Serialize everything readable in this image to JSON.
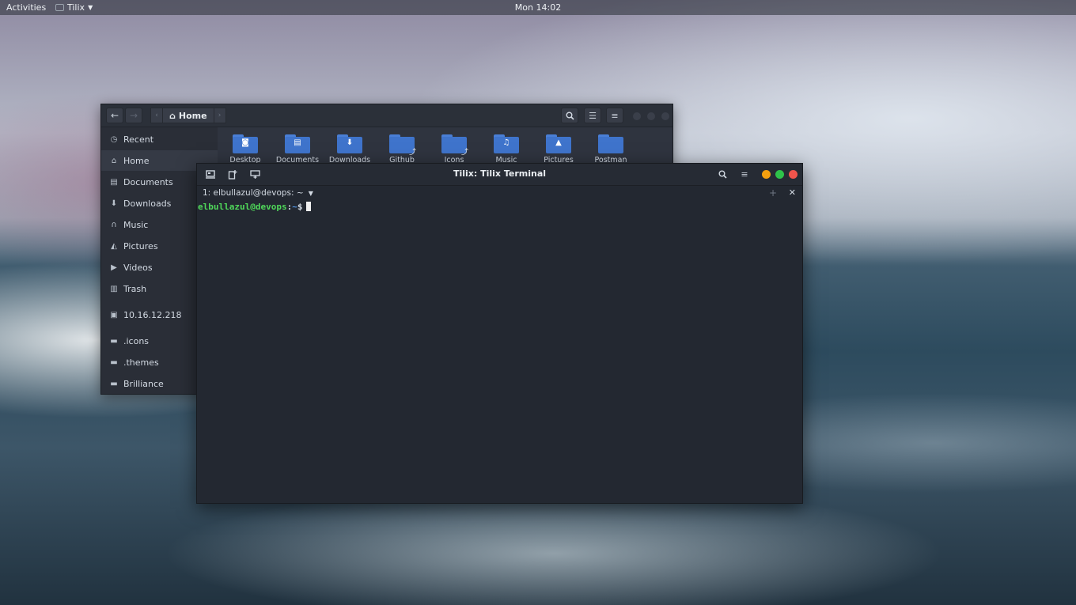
{
  "topbar": {
    "activities": "Activities",
    "app_name": "Tilix",
    "clock": "Mon 14:02"
  },
  "files": {
    "location": "Home",
    "sidebar": [
      {
        "label": "Recent",
        "icon": "clock-icon"
      },
      {
        "label": "Home",
        "icon": "home-icon",
        "active": true
      },
      {
        "label": "Documents",
        "icon": "document-icon"
      },
      {
        "label": "Downloads",
        "icon": "download-icon"
      },
      {
        "label": "Music",
        "icon": "headphones-icon"
      },
      {
        "label": "Pictures",
        "icon": "image-icon"
      },
      {
        "label": "Videos",
        "icon": "video-icon"
      },
      {
        "label": "Trash",
        "icon": "trash-icon"
      },
      {
        "label": "10.16.12.218",
        "icon": "network-folder-icon"
      },
      {
        "label": ".icons",
        "icon": "folder-icon"
      },
      {
        "label": ".themes",
        "icon": "folder-icon"
      },
      {
        "label": "Brilliance",
        "icon": "folder-icon"
      }
    ],
    "folders": [
      {
        "label": "Desktop",
        "icon": "desktop-folder-icon"
      },
      {
        "label": "Documents",
        "icon": "documents-folder-icon"
      },
      {
        "label": "Downloads",
        "icon": "downloads-folder-icon"
      },
      {
        "label": "Github",
        "icon": "symlink-folder-icon"
      },
      {
        "label": "Icons",
        "icon": "symlink-folder-icon"
      },
      {
        "label": "Music",
        "icon": "music-folder-icon"
      },
      {
        "label": "Pictures",
        "icon": "pictures-folder-icon"
      },
      {
        "label": "Postman",
        "icon": "folder-icon"
      }
    ]
  },
  "tilix": {
    "title": "Tilix: Tilix Terminal",
    "session": "1: elbullazul@devops: ~",
    "prompt": {
      "user_host": "elbullazul@devops",
      "colon": ":",
      "path": "~",
      "symbol": "$"
    }
  },
  "colors": {
    "close": "#f0544c",
    "maximize": "#2ec24a",
    "minimize": "#f5a00f",
    "folder_blue": "#3f74cc",
    "prompt_green": "#4fd85a"
  }
}
